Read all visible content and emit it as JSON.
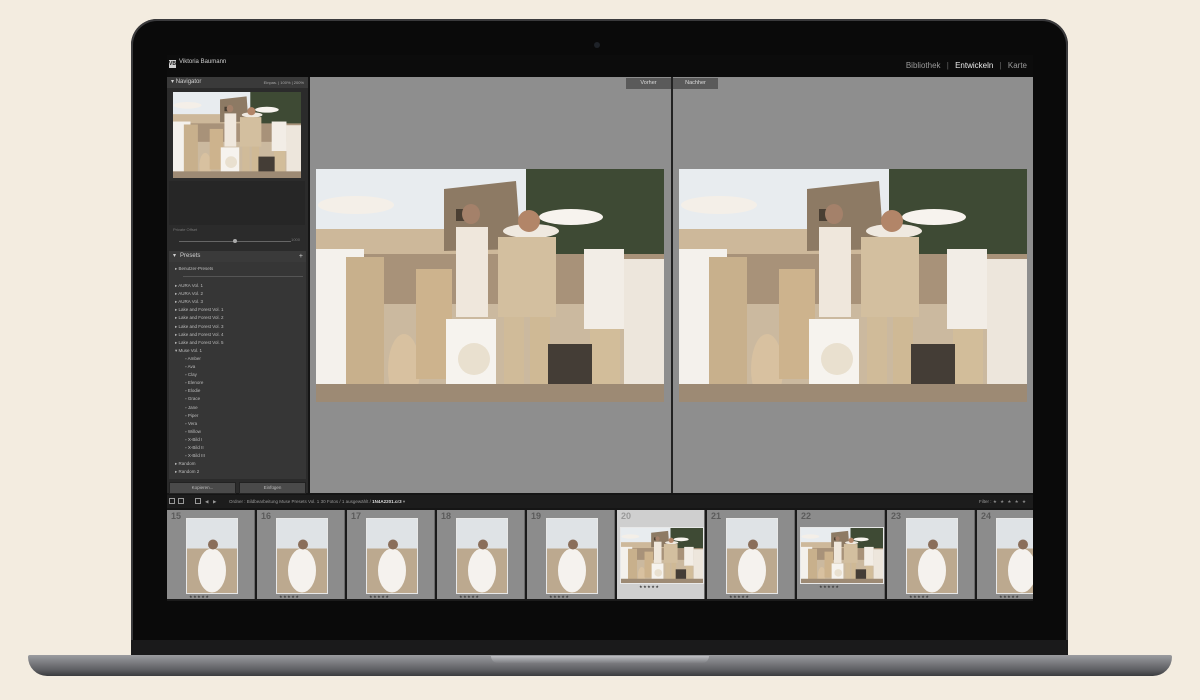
{
  "app": {
    "studio_name": "Viktoria Baumann",
    "logo_text": "VB",
    "modules": [
      "Bibliothek",
      "Entwickeln",
      "Karte"
    ],
    "active_module": "Entwickeln",
    "separator": "|"
  },
  "navigator": {
    "title": "Navigator",
    "zoom_options": "Einpas.  |  100%  |  200%"
  },
  "slider_panel": {
    "label": "Private Offset",
    "value": "1000"
  },
  "presets": {
    "title": "Presets",
    "add_icon": "plus-icon",
    "items": [
      {
        "label": "Benutzer-Presets",
        "level": 0,
        "icon": "triangle-right-icon"
      },
      {
        "label": "AURA Vol. 1",
        "level": 0,
        "icon": "triangle-right-icon"
      },
      {
        "label": "AURA Vol. 2",
        "level": 0,
        "icon": "triangle-right-icon"
      },
      {
        "label": "AURA Vol. 3",
        "level": 0,
        "icon": "triangle-right-icon"
      },
      {
        "label": "Lake and Forest Vol. 1",
        "level": 0,
        "icon": "triangle-right-icon"
      },
      {
        "label": "Lake and Forest Vol. 2",
        "level": 0,
        "icon": "triangle-right-icon"
      },
      {
        "label": "Lake and Forest Vol. 3",
        "level": 0,
        "icon": "triangle-right-icon"
      },
      {
        "label": "Lake and Forest Vol. 4",
        "level": 0,
        "icon": "triangle-right-icon"
      },
      {
        "label": "Lake and Forest Vol. 5",
        "level": 0,
        "icon": "triangle-right-icon"
      },
      {
        "label": "Muse Vol. 1",
        "level": 0,
        "icon": "triangle-down-icon"
      },
      {
        "label": "Amber",
        "level": 1,
        "icon": "preset-icon"
      },
      {
        "label": "Ava",
        "level": 1,
        "icon": "preset-icon"
      },
      {
        "label": "Clay",
        "level": 1,
        "icon": "preset-icon"
      },
      {
        "label": "Elenore",
        "level": 1,
        "icon": "preset-icon"
      },
      {
        "label": "Elodie",
        "level": 1,
        "icon": "preset-icon"
      },
      {
        "label": "Grace",
        "level": 1,
        "icon": "preset-icon"
      },
      {
        "label": "Jane",
        "level": 1,
        "icon": "preset-icon"
      },
      {
        "label": "Piper",
        "level": 1,
        "icon": "preset-icon"
      },
      {
        "label": "Vera",
        "level": 1,
        "icon": "preset-icon"
      },
      {
        "label": "Willow",
        "level": 1,
        "icon": "preset-icon"
      },
      {
        "label": "X-Bild I",
        "level": 1,
        "icon": "preset-icon"
      },
      {
        "label": "X-Bild II",
        "level": 1,
        "icon": "preset-icon"
      },
      {
        "label": "X-Bild III",
        "level": 1,
        "icon": "preset-icon"
      },
      {
        "label": "Random",
        "level": 0,
        "icon": "triangle-right-icon"
      },
      {
        "label": "Random 2",
        "level": 0,
        "icon": "triangle-right-icon"
      }
    ],
    "copy_button": "Kopieren...",
    "paste_button": "Einfügen"
  },
  "compare": {
    "before_label": "Vorher",
    "after_label": "Nachher"
  },
  "filmstrip_toolbar": {
    "path_prefix": "Ordner : Bildbearbeitung Muse Presets Vol. 1",
    "count": "30 Fotos / 1 ausgewählt /",
    "filename": "1N4A2201.cr3",
    "filter_label": "Filter :",
    "stars": "★ ★ ★ ★ ★"
  },
  "filmstrip": {
    "selected": "20",
    "cells": [
      {
        "num": "15",
        "stars": "★★★★★"
      },
      {
        "num": "16",
        "stars": "★★★★★"
      },
      {
        "num": "17",
        "stars": "★★★★★"
      },
      {
        "num": "18",
        "stars": "★★★★★"
      },
      {
        "num": "19",
        "stars": "★★★★★"
      },
      {
        "num": "20",
        "stars": "★★★★★"
      },
      {
        "num": "21",
        "stars": "★★★★★"
      },
      {
        "num": "22",
        "stars": "★★★★★"
      },
      {
        "num": "23",
        "stars": "★★★★★"
      },
      {
        "num": "24",
        "stars": "★★★★★"
      }
    ]
  },
  "colors": {
    "background": "#f3ece0",
    "panel": "#2b2b2b",
    "canvas": "#8e8e8e",
    "selected_cell": "#cfcfcf"
  }
}
